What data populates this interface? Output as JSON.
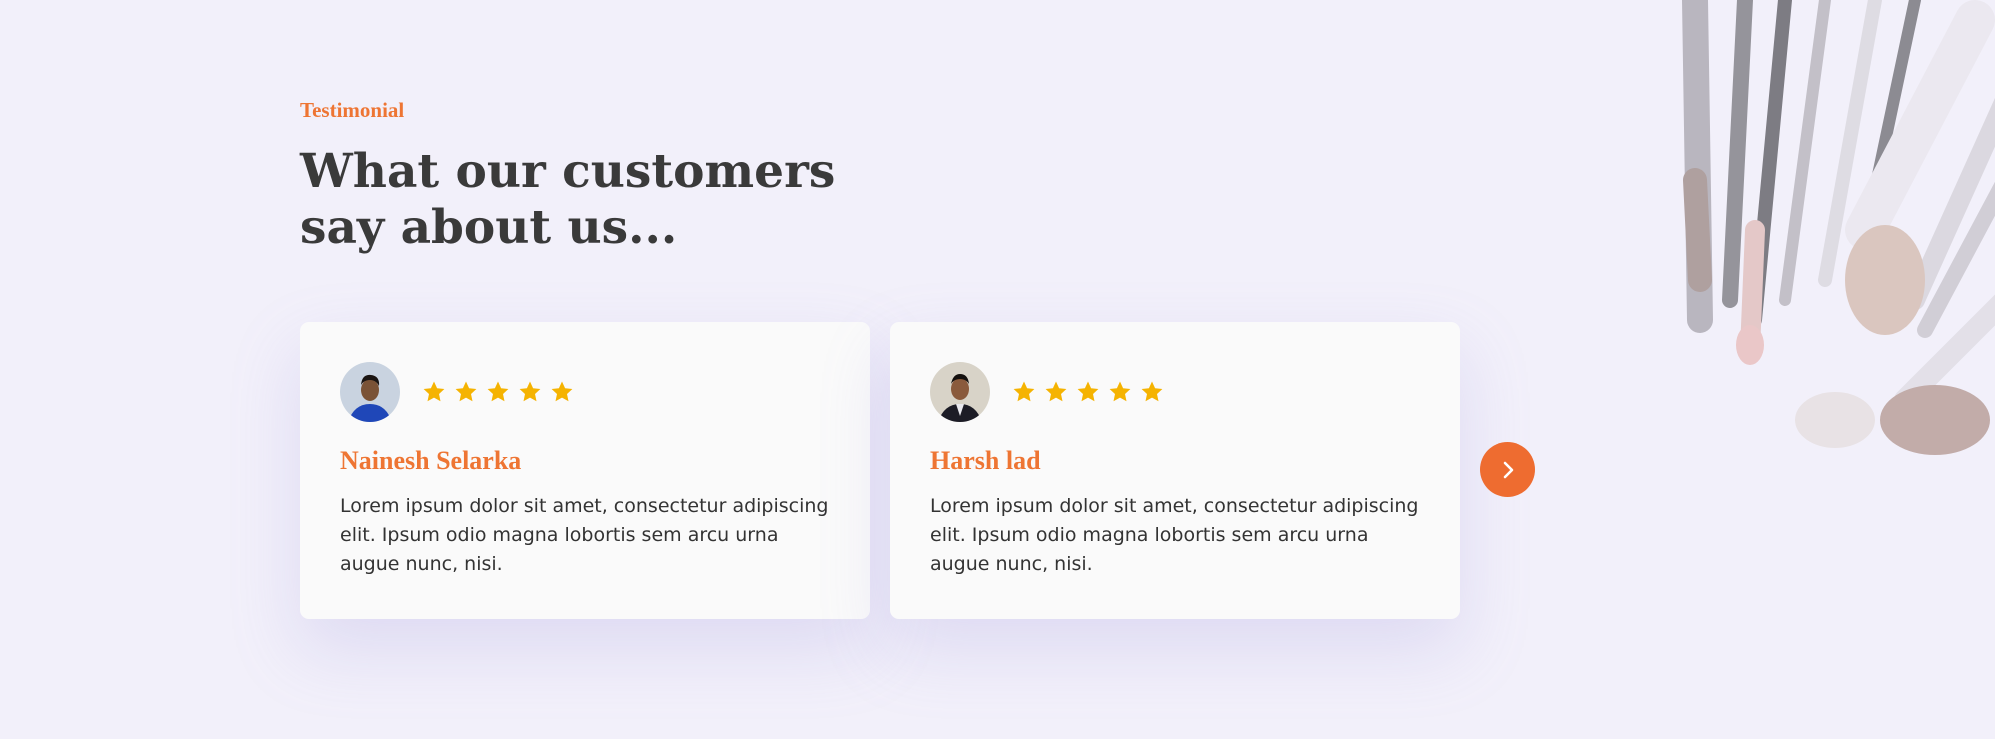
{
  "section": {
    "eyebrow": "Testimonial",
    "heading": "What our customers say about us..."
  },
  "testimonials": [
    {
      "name": "Nainesh Selarka",
      "rating": 5,
      "text": "Lorem ipsum dolor sit amet, consectetur adipiscing elit. Ipsum odio magna lobortis sem arcu urna augue nunc, nisi."
    },
    {
      "name": "Harsh lad",
      "rating": 5,
      "text": "Lorem ipsum dolor sit amet, consectetur adipiscing elit. Ipsum odio magna lobortis sem arcu urna augue nunc, nisi."
    }
  ],
  "icons": {
    "star": "star-icon",
    "next": "chevron-right-icon"
  },
  "colors": {
    "accent": "#ee7533",
    "star": "#f5b301",
    "background": "#f2f0fa",
    "card": "#fafafa",
    "heading": "#3a3a3a"
  }
}
